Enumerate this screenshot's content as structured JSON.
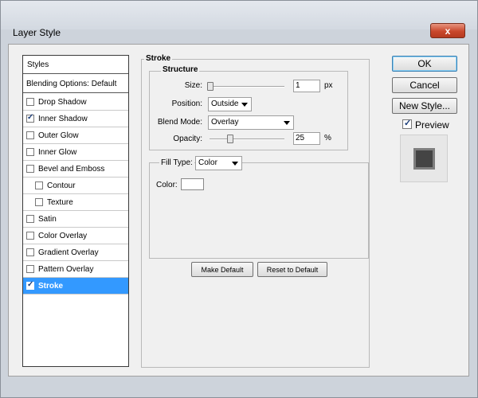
{
  "window": {
    "title": "Layer Style"
  },
  "close_button": {
    "label": "x"
  },
  "styles_panel": {
    "header": "Styles",
    "blending": "Blending Options: Default",
    "items": [
      {
        "label": "Drop Shadow",
        "checked": false,
        "indent": false,
        "selected": false
      },
      {
        "label": "Inner Shadow",
        "checked": true,
        "indent": false,
        "selected": false
      },
      {
        "label": "Outer Glow",
        "checked": false,
        "indent": false,
        "selected": false
      },
      {
        "label": "Inner Glow",
        "checked": false,
        "indent": false,
        "selected": false
      },
      {
        "label": "Bevel and Emboss",
        "checked": false,
        "indent": false,
        "selected": false
      },
      {
        "label": "Contour",
        "checked": false,
        "indent": true,
        "selected": false
      },
      {
        "label": "Texture",
        "checked": false,
        "indent": true,
        "selected": false
      },
      {
        "label": "Satin",
        "checked": false,
        "indent": false,
        "selected": false
      },
      {
        "label": "Color Overlay",
        "checked": false,
        "indent": false,
        "selected": false
      },
      {
        "label": "Gradient Overlay",
        "checked": false,
        "indent": false,
        "selected": false
      },
      {
        "label": "Pattern Overlay",
        "checked": false,
        "indent": false,
        "selected": false
      },
      {
        "label": "Stroke",
        "checked": true,
        "indent": false,
        "selected": true
      }
    ]
  },
  "stroke": {
    "group_title": "Stroke",
    "structure_title": "Structure",
    "size_label": "Size:",
    "size_value": "1",
    "size_unit": "px",
    "position_label": "Position:",
    "position_value": "Outside",
    "blend_label": "Blend Mode:",
    "blend_value": "Overlay",
    "opacity_label": "Opacity:",
    "opacity_value": "25",
    "opacity_unit": "%",
    "fill_type_label": "Fill Type:",
    "fill_type_value": "Color",
    "color_label": "Color:",
    "color_value": "#ffffff",
    "make_default": "Make Default",
    "reset_default": "Reset to Default"
  },
  "buttons": {
    "ok": "OK",
    "cancel": "Cancel",
    "new_style": "New Style...",
    "preview": "Preview"
  },
  "colors": {
    "selection": "#3399ff",
    "client_bg": "#f0f0f0"
  }
}
